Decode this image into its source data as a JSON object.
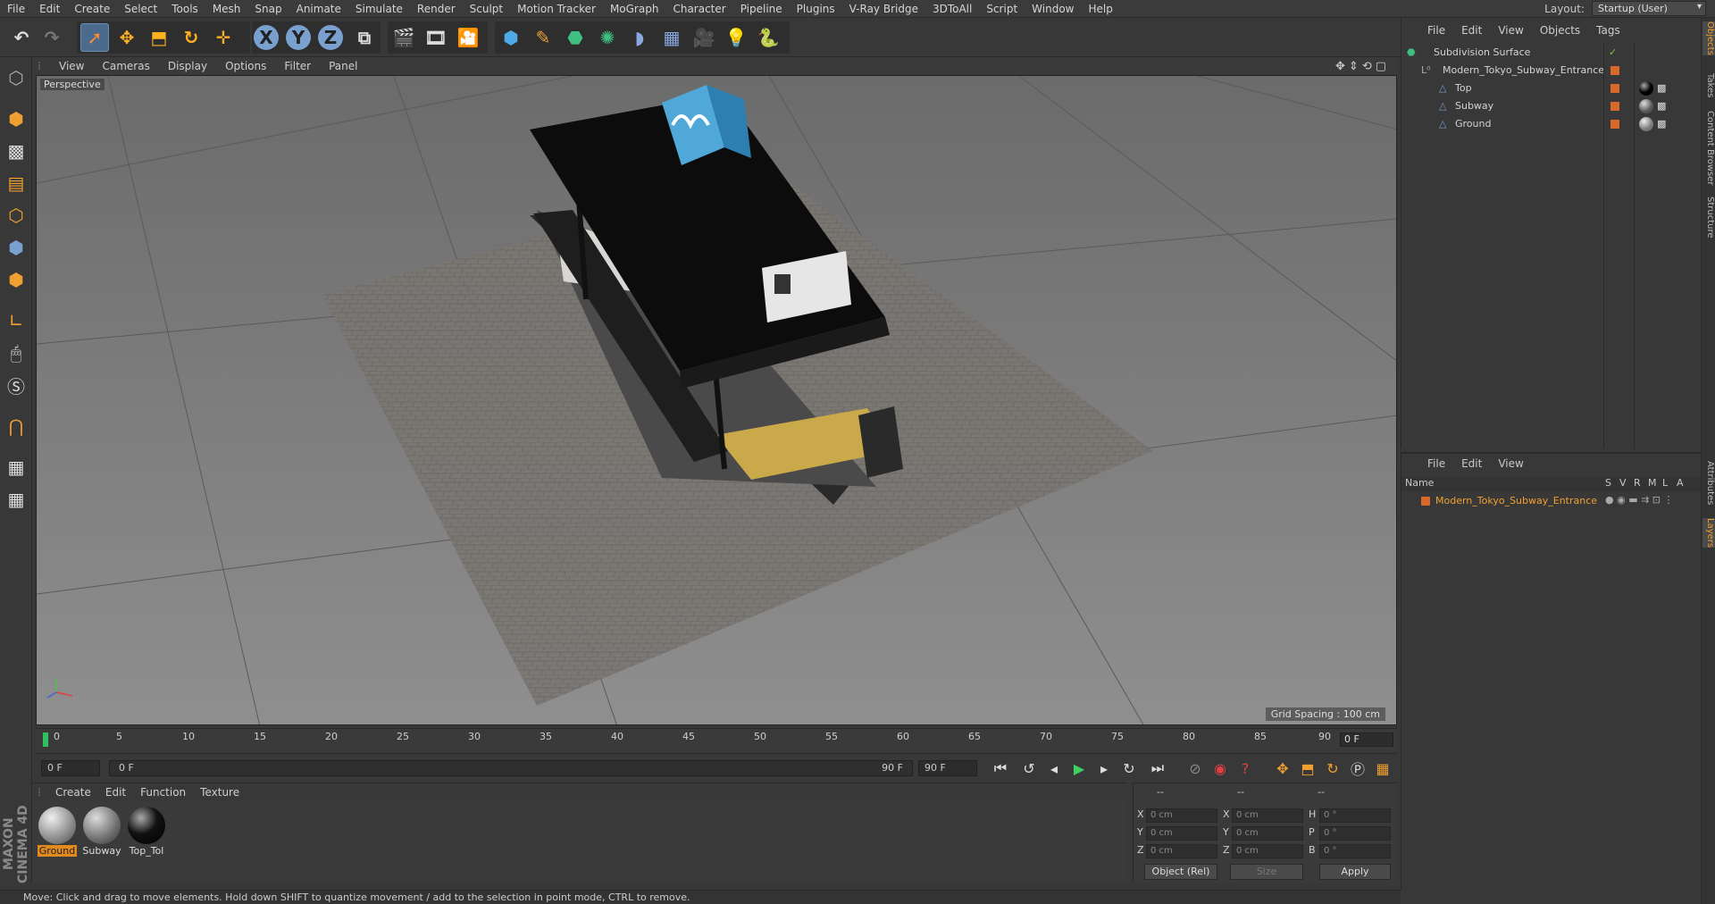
{
  "menubar": {
    "items": [
      "File",
      "Edit",
      "Create",
      "Select",
      "Tools",
      "Mesh",
      "Snap",
      "Animate",
      "Simulate",
      "Render",
      "Sculpt",
      "Motion Tracker",
      "MoGraph",
      "Character",
      "Pipeline",
      "Plugins",
      "V-Ray Bridge",
      "3DToAll",
      "Script",
      "Window",
      "Help"
    ],
    "layout_label": "Layout:",
    "layout_value": "Startup (User)"
  },
  "toolbar": {
    "axis_x": "X",
    "axis_y": "Y",
    "axis_z": "Z"
  },
  "viewport": {
    "menu": [
      "View",
      "Cameras",
      "Display",
      "Options",
      "Filter",
      "Panel"
    ],
    "label": "Perspective",
    "grid_spacing": "Grid Spacing : 100 cm"
  },
  "timeline": {
    "ticks": [
      "0",
      "5",
      "10",
      "15",
      "20",
      "25",
      "30",
      "35",
      "40",
      "45",
      "50",
      "55",
      "60",
      "65",
      "70",
      "75",
      "80",
      "85",
      "90"
    ],
    "current_frame": "0 F"
  },
  "transport": {
    "start_field": "0 F",
    "range_start": "0 F",
    "range_end": "90 F",
    "end_field": "90 F"
  },
  "materials": {
    "menu": [
      "Create",
      "Edit",
      "Function",
      "Texture"
    ],
    "items": [
      {
        "name": "Ground",
        "selected": true
      },
      {
        "name": "Subway",
        "selected": false
      },
      {
        "name": "Top_Tol",
        "selected": false
      }
    ]
  },
  "coordinates": {
    "header": [
      "--",
      "--",
      "--"
    ],
    "rows": [
      {
        "l1": "X",
        "v1": "0 cm",
        "l2": "X",
        "v2": "0 cm",
        "l3": "H",
        "v3": "0 °"
      },
      {
        "l1": "Y",
        "v1": "0 cm",
        "l2": "Y",
        "v2": "0 cm",
        "l3": "P",
        "v3": "0 °"
      },
      {
        "l1": "Z",
        "v1": "0 cm",
        "l2": "Z",
        "v2": "0 cm",
        "l3": "B",
        "v3": "0 °"
      }
    ],
    "mode": "Object (Rel)",
    "size_mode": "Size",
    "apply": "Apply"
  },
  "objects": {
    "menu": [
      "File",
      "Edit",
      "View",
      "Objects",
      "Tags"
    ],
    "tree": [
      {
        "name": "Subdivision Surface",
        "indent": 0
      },
      {
        "name": "Modern_Tokyo_Subway_Entrance",
        "indent": 1
      },
      {
        "name": "Top",
        "indent": 2
      },
      {
        "name": "Subway",
        "indent": 2
      },
      {
        "name": "Ground",
        "indent": 2
      }
    ]
  },
  "layers": {
    "menu": [
      "File",
      "Edit",
      "View"
    ],
    "columns": [
      "Name",
      "S",
      "V",
      "R",
      "M",
      "L",
      "A"
    ],
    "rows": [
      {
        "name": "Modern_Tokyo_Subway_Entrance"
      }
    ]
  },
  "right_tabs": [
    "Objects",
    "Takes",
    "Content Browser",
    "Structure",
    "Attributes",
    "Layers"
  ],
  "logo": "MAXON CINEMA 4D",
  "status": "Move: Click and drag to move elements. Hold down SHIFT to quantize movement / add to the selection in point mode, CTRL to remove.",
  "colors": {
    "accent": "#d8692a",
    "selected_text": "#f0a030",
    "playhead": "#30c060"
  }
}
